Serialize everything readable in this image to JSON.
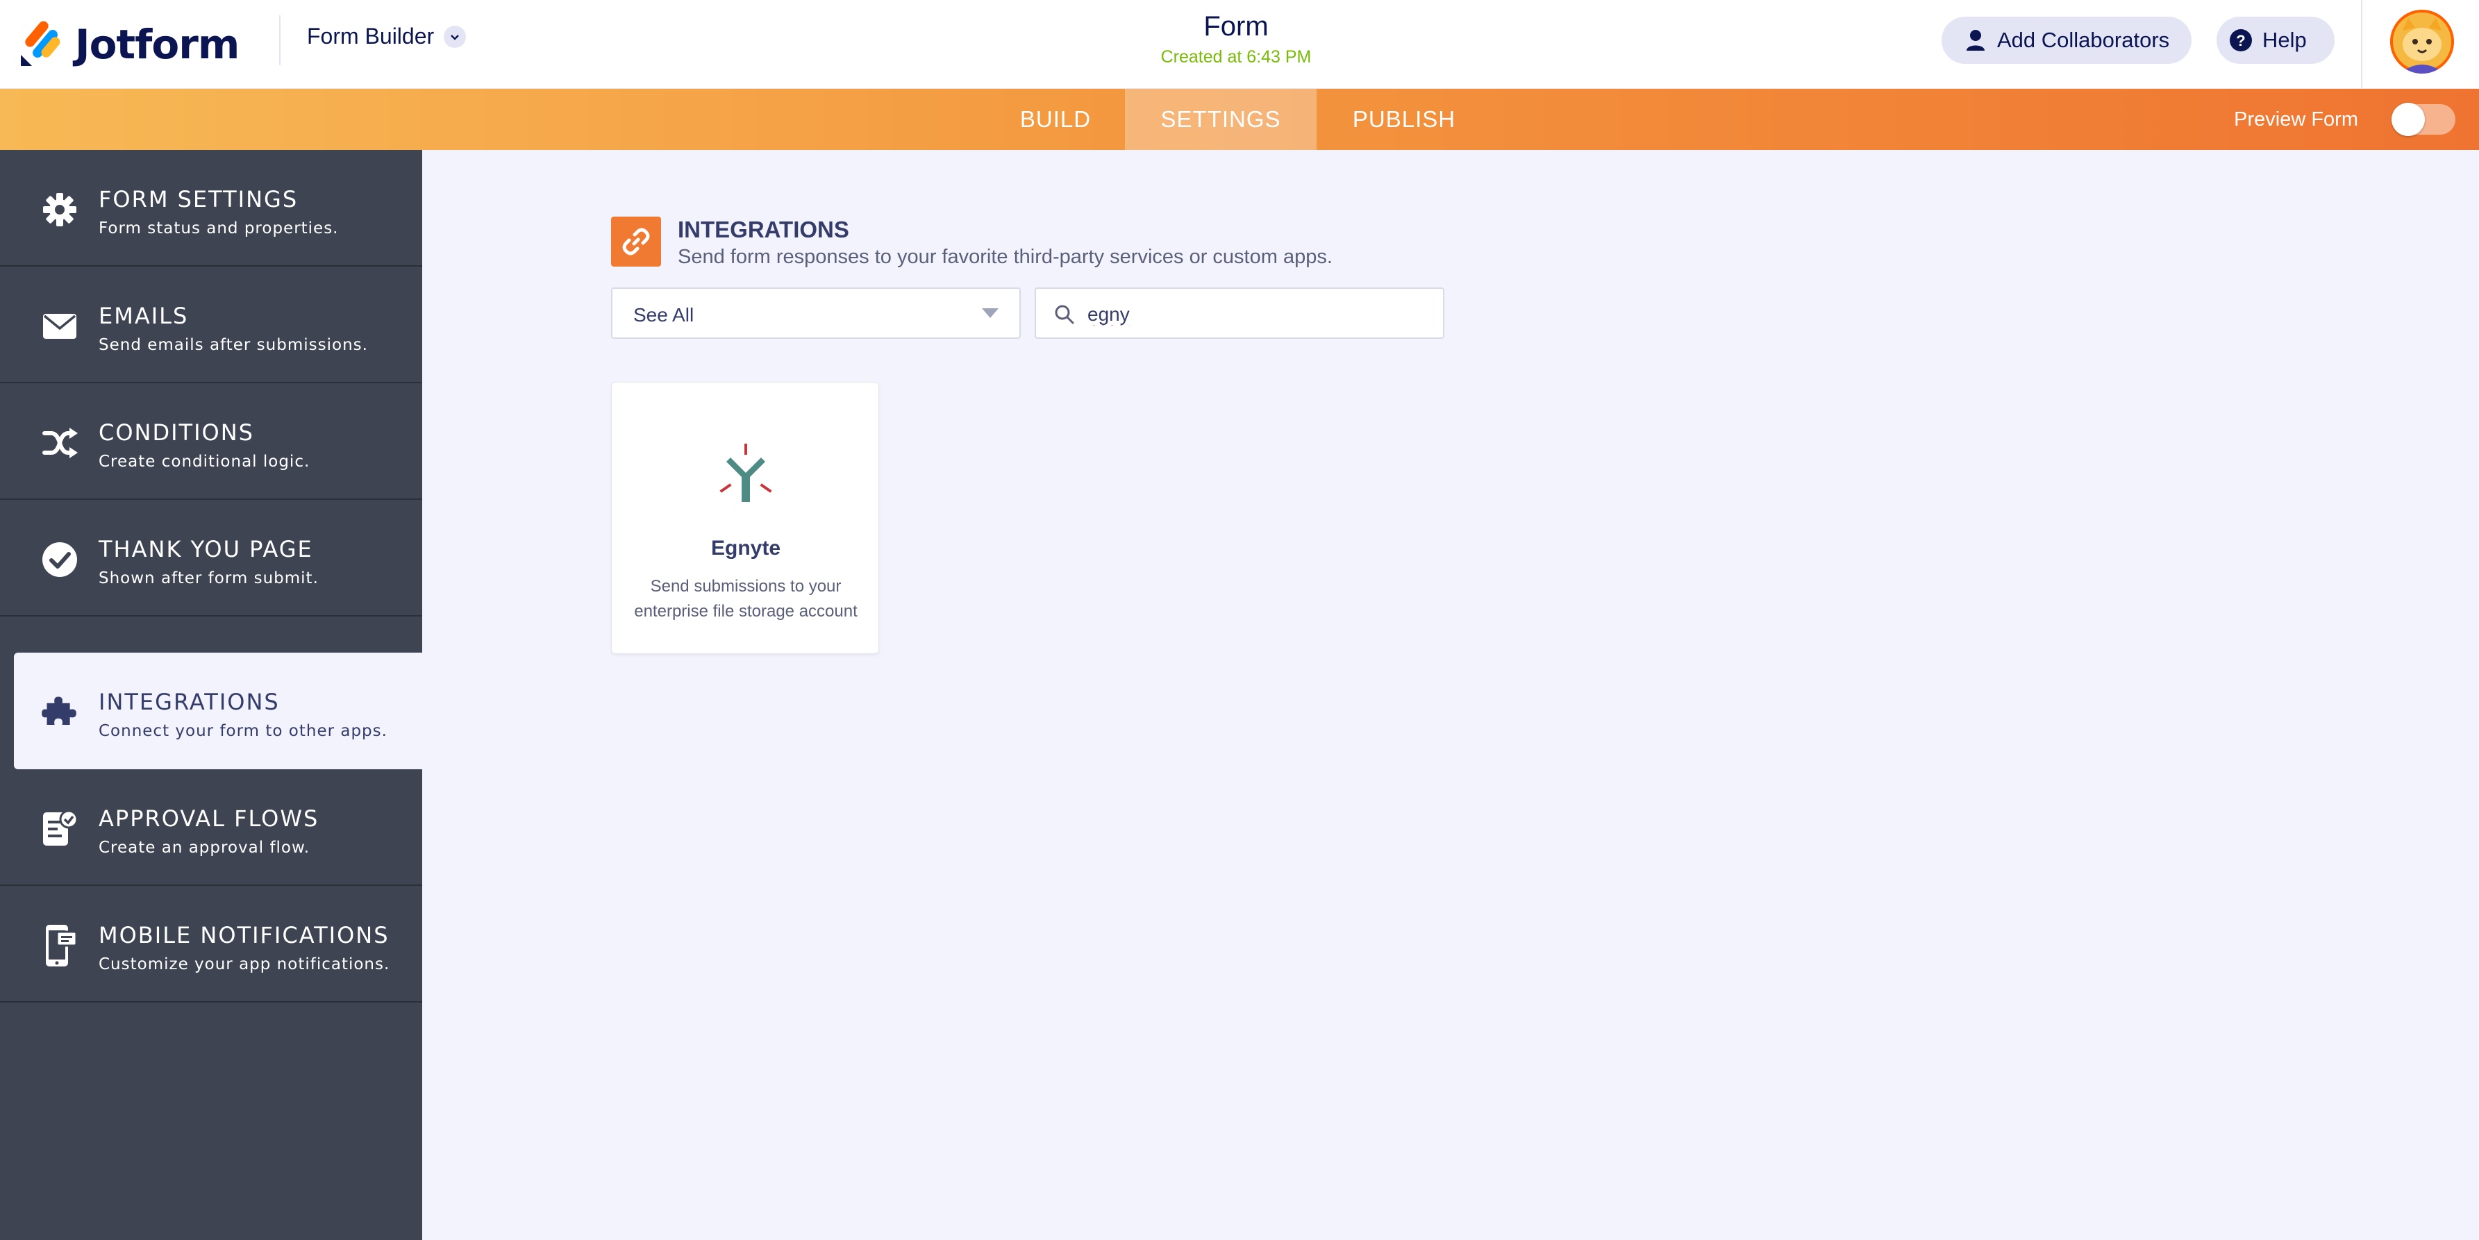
{
  "header": {
    "logo_text": "Jotform",
    "builder_menu_label": "Form Builder",
    "form_title": "Form",
    "form_created": "Created at 6:43 PM",
    "add_collaborators_label": "Add Collaborators",
    "help_label": "Help"
  },
  "nav": {
    "tabs": [
      {
        "label": "BUILD",
        "active": false
      },
      {
        "label": "SETTINGS",
        "active": true
      },
      {
        "label": "PUBLISH",
        "active": false
      }
    ],
    "preview_label": "Preview Form",
    "preview_enabled": false
  },
  "sidebar": {
    "items": [
      {
        "title": "FORM SETTINGS",
        "subtitle": "Form status and properties.",
        "icon": "gear-icon"
      },
      {
        "title": "EMAILS",
        "subtitle": "Send emails after submissions.",
        "icon": "envelope-icon"
      },
      {
        "title": "CONDITIONS",
        "subtitle": "Create conditional logic.",
        "icon": "shuffle-icon"
      },
      {
        "title": "THANK YOU PAGE",
        "subtitle": "Shown after form submit.",
        "icon": "check-circle-icon"
      },
      {
        "title": "INTEGRATIONS",
        "subtitle": "Connect your form to other apps.",
        "icon": "puzzle-icon",
        "active": true
      },
      {
        "title": "APPROVAL FLOWS",
        "subtitle": "Create an approval flow.",
        "icon": "approval-icon"
      },
      {
        "title": "MOBILE NOTIFICATIONS",
        "subtitle": "Customize your app notifications.",
        "icon": "mobile-notification-icon"
      }
    ]
  },
  "main": {
    "section_title": "INTEGRATIONS",
    "section_subtitle": "Send form responses to your favorite third-party services or custom apps.",
    "filter_value": "See All",
    "search_value": "egny",
    "results": [
      {
        "name": "Egnyte",
        "description": "Send submissions to your enterprise file storage account",
        "icon": "egnyte-logo-icon"
      }
    ]
  },
  "colors": {
    "brand_orange": "#f07a32",
    "sidebar_bg": "#3e4452",
    "created_green": "#78bb07",
    "navy": "#0a1551"
  }
}
